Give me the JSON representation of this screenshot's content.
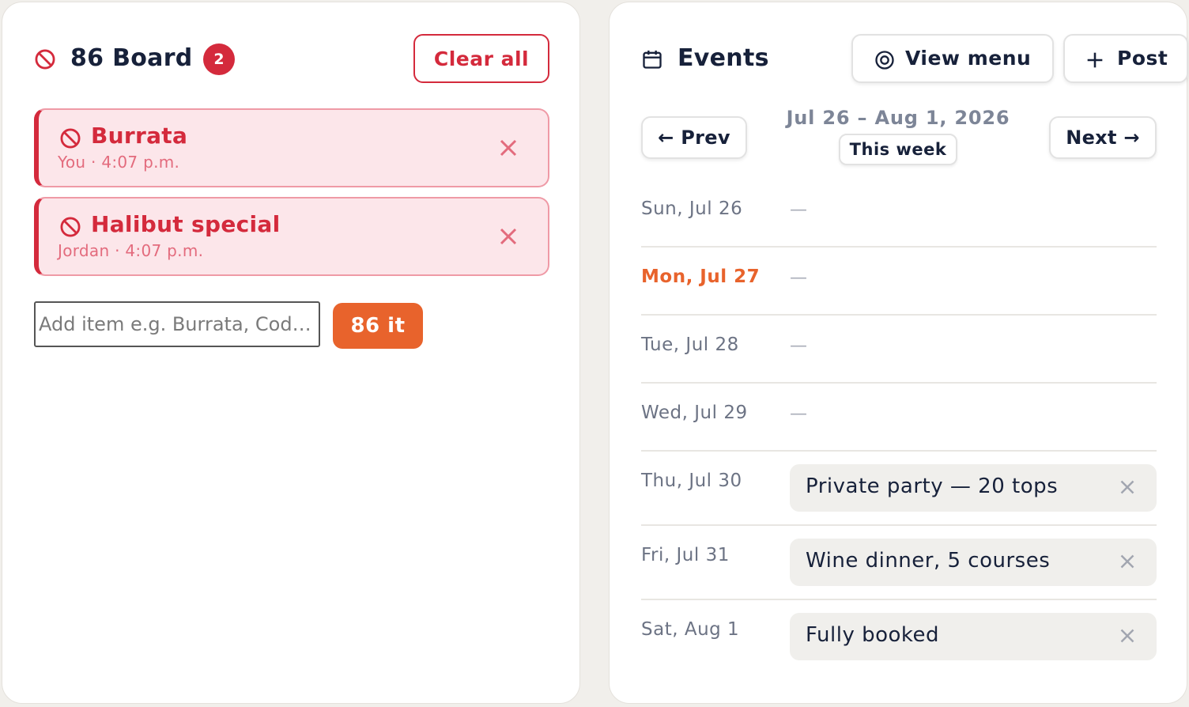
{
  "board": {
    "title": "86 Board",
    "count": "2",
    "clear_label": "Clear all",
    "items": [
      {
        "name": "Burrata",
        "meta": "You · 4:07 p.m."
      },
      {
        "name": "Halibut special",
        "meta": "Jordan · 4:07 p.m."
      }
    ],
    "input_placeholder": "Add item e.g. Burrata, Cod…",
    "add_label": "86 it"
  },
  "events": {
    "title": "Events",
    "view_menu_label": "View menu",
    "post_label": "Post",
    "prev_label": "← Prev",
    "next_label": "Next →",
    "week_range": "Jul 26 – Aug 1, 2026",
    "week_tag": "This week",
    "days": [
      {
        "label": "Sun, Jul 26",
        "empty": "—"
      },
      {
        "label": "Mon, Jul 27",
        "empty": "—"
      },
      {
        "label": "Tue, Jul 28",
        "empty": "—"
      },
      {
        "label": "Wed, Jul 29",
        "empty": "—"
      },
      {
        "label": "Thu, Jul 30",
        "event": "Private party — 20 tops"
      },
      {
        "label": "Fri, Jul 31",
        "event": "Wine dinner, 5 courses"
      },
      {
        "label": "Sat, Aug 1",
        "event": "Fully booked"
      }
    ]
  },
  "colors": {
    "accent_red": "#d42a3c",
    "accent_orange": "#e8632c",
    "text_dark": "#17213a"
  }
}
